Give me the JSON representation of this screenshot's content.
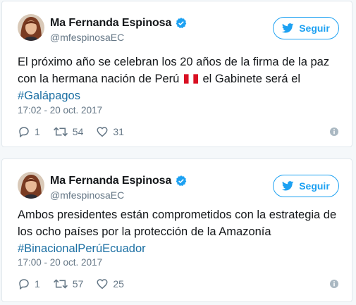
{
  "tweets": [
    {
      "display_name": "Ma Fernanda Espinosa",
      "handle": "@mfespinosaEC",
      "follow_label": "Seguir",
      "text_before_flag": "El próximo año se celebran los 20 años de la firma de la paz con la hermana nación de Perú ",
      "text_after_flag": " el Gabinete será el ",
      "hashtag": "#Galápagos",
      "timestamp": "17:02 - 20 oct. 2017",
      "replies": "1",
      "retweets": "54",
      "likes": "31"
    },
    {
      "display_name": "Ma Fernanda Espinosa",
      "handle": "@mfespinosaEC",
      "follow_label": "Seguir",
      "text": "Ambos presidentes están comprometidos con la estrategia de los ocho países por la protección de la Amazonía ",
      "hashtag": "#BinacionalPerúEcuador",
      "timestamp": "17:00 - 20 oct. 2017",
      "replies": "1",
      "retweets": "57",
      "likes": "25"
    }
  ],
  "colors": {
    "accent": "#1da1f2",
    "hashtag": "#1b6fa3",
    "muted": "#657786"
  },
  "icons": [
    "verified-badge-icon",
    "twitter-bird-icon",
    "reply-icon",
    "retweet-icon",
    "like-heart-icon",
    "info-icon",
    "peru-flag-icon"
  ]
}
